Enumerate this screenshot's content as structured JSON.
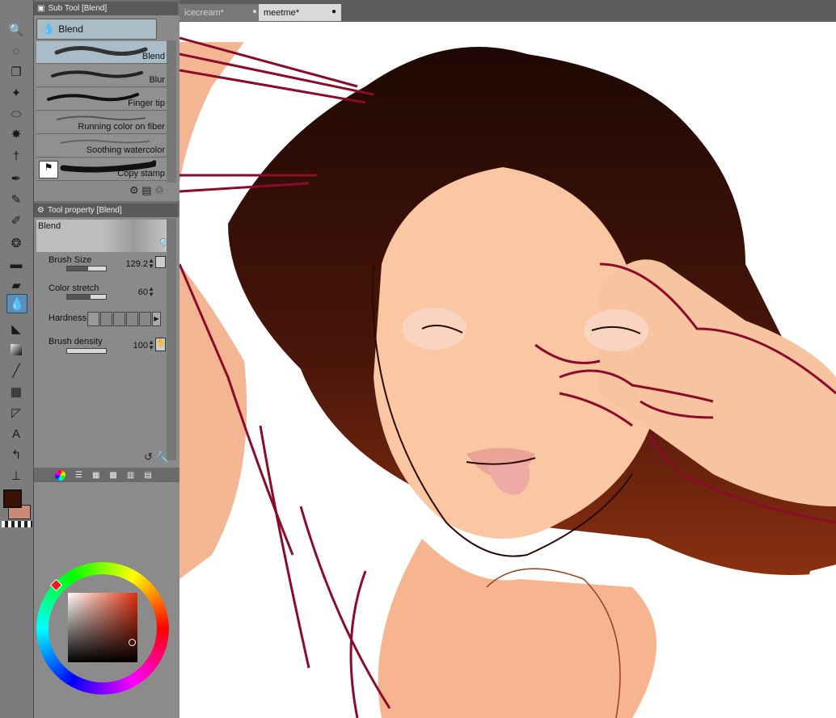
{
  "subtool_panel": {
    "title": "Sub Tool [Blend]",
    "group_label": "Blend",
    "items": [
      {
        "label": "Blend",
        "selected": true
      },
      {
        "label": "Blur",
        "selected": false
      },
      {
        "label": "Finger tip",
        "selected": false
      },
      {
        "label": "Running color on fiber",
        "selected": false
      },
      {
        "label": "Soothing watercolor",
        "selected": false
      },
      {
        "label": "Copy stamp",
        "selected": false
      }
    ]
  },
  "tool_property": {
    "title": "Tool property [Blend]",
    "preview_label": "Blend",
    "properties": [
      {
        "name": "Brush Size",
        "value": "129.2",
        "fill": 0.55
      },
      {
        "name": "Color stretch",
        "value": "60",
        "fill": 0.6
      },
      {
        "name": "Hardness",
        "value": "",
        "fill": 0
      },
      {
        "name": "Brush density",
        "value": "100",
        "fill": 1.0
      }
    ]
  },
  "tabs": [
    {
      "label": "icecream*",
      "active": false
    },
    {
      "label": "meetme*",
      "active": true
    }
  ],
  "colors": {
    "main": "#3a1208",
    "sub": "#c98a76",
    "accent": "#5c8db8",
    "picked": "#7a2a1c"
  },
  "toolbar_icons": [
    "zoom-icon",
    "lasso-icon",
    "move-icon",
    "transform-icon",
    "ellipse-select-icon",
    "magic-wand-icon",
    "eyedropper-icon",
    "pen-icon",
    "pencil-icon",
    "brush-icon",
    "airbrush-icon",
    "decoration-icon",
    "eraser-icon",
    "blend-icon",
    "fill-icon",
    "gradient-icon",
    "line-icon",
    "frame-icon",
    "ruler-icon",
    "text-icon",
    "balloon-icon",
    "correct-line-icon"
  ]
}
